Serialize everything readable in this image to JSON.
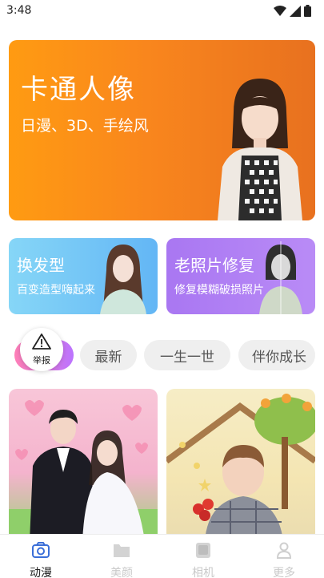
{
  "status_bar": {
    "time": "3:48"
  },
  "hero": {
    "title": "卡通人像",
    "subtitle": "日漫、3D、手绘风"
  },
  "cards": [
    {
      "title": "换发型",
      "subtitle": "百变造型嗨起来"
    },
    {
      "title": "老照片修复",
      "subtitle": "修复模糊破损照片"
    }
  ],
  "chips": {
    "active_index": 0,
    "items": [
      "",
      "最新",
      "一生一世",
      "伴你成长"
    ]
  },
  "report": {
    "label": "举报"
  },
  "bottom_nav": {
    "active_index": 0,
    "items": [
      {
        "label": "动漫",
        "icon": "camera-icon"
      },
      {
        "label": "美颜",
        "icon": "folder-icon"
      },
      {
        "label": "相机",
        "icon": "image-icon"
      },
      {
        "label": "更多",
        "icon": "person-icon"
      }
    ]
  },
  "colors": {
    "hero_gradient": [
      "#ff9b12",
      "#e8711f"
    ],
    "hair_card": "#63b6f5",
    "photo_card": "#a977f2",
    "chip_active": [
      "#ff7fb7",
      "#bb73ff"
    ],
    "nav_active": "#3b6fd8"
  }
}
